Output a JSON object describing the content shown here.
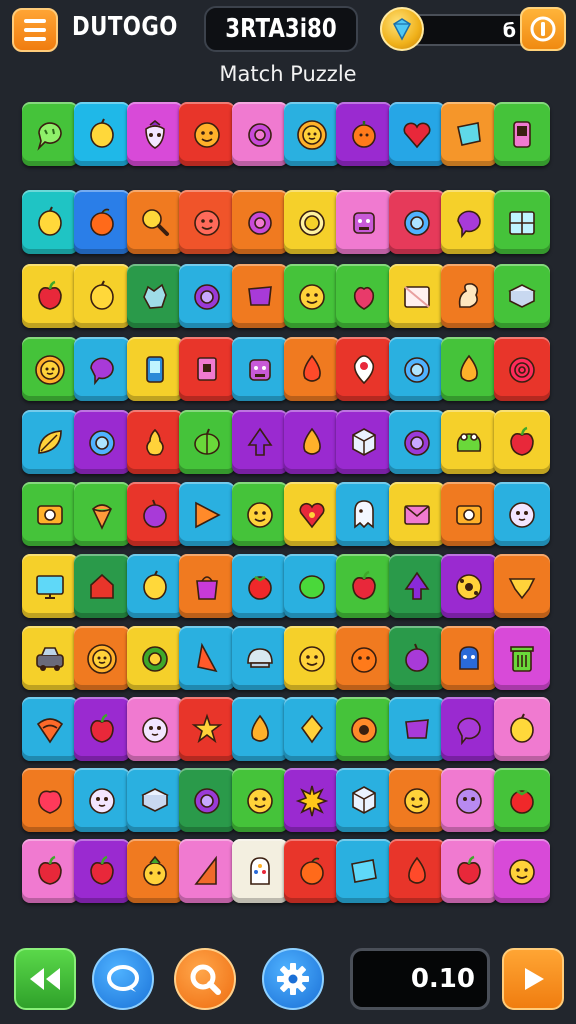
{
  "header": {
    "brand": "DUTOGO",
    "code": "3RTA3i80",
    "coin_count": "б",
    "subtitle": "Match Puzzle"
  },
  "footer": {
    "timer": "0.10"
  },
  "board": {
    "rows": [
      [
        {
          "icon": "speech-bubble",
          "color": "#45c33a"
        },
        {
          "icon": "lemon",
          "color": "#1fb8e8"
        },
        {
          "icon": "strawberry",
          "color": "#d84ad8"
        },
        {
          "icon": "smiley-orange",
          "color": "#e8352a"
        },
        {
          "icon": "ring",
          "color": "#f07ad0"
        },
        {
          "icon": "sun-face",
          "color": "#2ab0e0"
        },
        {
          "icon": "orange-face",
          "color": "#9a2ad0"
        },
        {
          "icon": "heart",
          "color": "#26a6e6"
        },
        {
          "icon": "gem-square",
          "color": "#f5962a"
        },
        {
          "icon": "phone",
          "color": "#45c33a"
        }
      ],
      [
        {
          "icon": "lemon",
          "color": "#1fc4c4"
        },
        {
          "icon": "orange",
          "color": "#2a7ee8"
        },
        {
          "icon": "magnifier",
          "color": "#f07a20"
        },
        {
          "icon": "smiley-red",
          "color": "#f0542a"
        },
        {
          "icon": "ring",
          "color": "#f07a20"
        },
        {
          "icon": "ring-yellow",
          "color": "#f5d02a"
        },
        {
          "icon": "robot",
          "color": "#f07ad0"
        },
        {
          "icon": "ring-blue",
          "color": "#e63a5a"
        },
        {
          "icon": "bubble-purple",
          "color": "#f5d02a"
        },
        {
          "icon": "window",
          "color": "#45c33a"
        }
      ],
      [
        {
          "icon": "apple",
          "color": "#f5d02a"
        },
        {
          "icon": "lemon",
          "color": "#f5d02a"
        },
        {
          "icon": "splat",
          "color": "#2a9a4a"
        },
        {
          "icon": "ring-purple",
          "color": "#2ab0e0"
        },
        {
          "icon": "gem-purple",
          "color": "#f07a20"
        },
        {
          "icon": "smiley-yellow",
          "color": "#45c33a"
        },
        {
          "icon": "berry",
          "color": "#45c33a"
        },
        {
          "icon": "card",
          "color": "#f5d02a"
        },
        {
          "icon": "squirrel",
          "color": "#f07a20"
        },
        {
          "icon": "book",
          "color": "#45c33a"
        }
      ],
      [
        {
          "icon": "sun-face",
          "color": "#45c33a"
        },
        {
          "icon": "bubble-purple",
          "color": "#2ab0e0"
        },
        {
          "icon": "phone-blue",
          "color": "#f5d02a"
        },
        {
          "icon": "box-pink",
          "color": "#e8352a"
        },
        {
          "icon": "robot",
          "color": "#2ab0e0"
        },
        {
          "icon": "drop-red",
          "color": "#f07a20"
        },
        {
          "icon": "pin-red",
          "color": "#e8352a"
        },
        {
          "icon": "ring-blue",
          "color": "#2ab0e0"
        },
        {
          "icon": "drop-orange",
          "color": "#45c33a"
        },
        {
          "icon": "rose",
          "color": "#e8352a"
        }
      ],
      [
        {
          "icon": "leaf",
          "color": "#2ab0e0"
        },
        {
          "icon": "ring-blue",
          "color": "#9a2ad0"
        },
        {
          "icon": "pear",
          "color": "#e8352a"
        },
        {
          "icon": "pumpkin",
          "color": "#45c33a"
        },
        {
          "icon": "arrow-up",
          "color": "#9a2ad0"
        },
        {
          "icon": "drop-orange",
          "color": "#9a2ad0"
        },
        {
          "icon": "cube",
          "color": "#9a2ad0"
        },
        {
          "icon": "ring-purple",
          "color": "#2ab0e0"
        },
        {
          "icon": "frog",
          "color": "#f5d02a"
        },
        {
          "icon": "apple",
          "color": "#f5d02a"
        }
      ],
      [
        {
          "icon": "camera",
          "color": "#45c33a"
        },
        {
          "icon": "acorn",
          "color": "#45c33a"
        },
        {
          "icon": "plum",
          "color": "#e8352a"
        },
        {
          "icon": "triangle",
          "color": "#2ab0e0"
        },
        {
          "icon": "smiley-yellow",
          "color": "#45c33a"
        },
        {
          "icon": "heart-red",
          "color": "#f5d02a"
        },
        {
          "icon": "ghost",
          "color": "#2ab0e0"
        },
        {
          "icon": "envelope",
          "color": "#f5d02a"
        },
        {
          "icon": "camera",
          "color": "#f07a20"
        },
        {
          "icon": "ghost-face",
          "color": "#2ab0e0"
        }
      ],
      [
        {
          "icon": "monitor",
          "color": "#f5d02a"
        },
        {
          "icon": "house-red",
          "color": "#2a9a4a"
        },
        {
          "icon": "lemon",
          "color": "#2ab0e0"
        },
        {
          "icon": "bag",
          "color": "#f07a20"
        },
        {
          "icon": "tomato",
          "color": "#2ab0e0"
        },
        {
          "icon": "lime",
          "color": "#2ab0e0"
        },
        {
          "icon": "apple",
          "color": "#45c33a"
        },
        {
          "icon": "arrow-up",
          "color": "#2a9a4a"
        },
        {
          "icon": "sun-wheel",
          "color": "#9a2ad0"
        },
        {
          "icon": "banana",
          "color": "#f07a20"
        }
      ],
      [
        {
          "icon": "car",
          "color": "#f5d02a"
        },
        {
          "icon": "sun-face",
          "color": "#f07a20"
        },
        {
          "icon": "ring-green",
          "color": "#f5d02a"
        },
        {
          "icon": "wedge",
          "color": "#2ab0e0"
        },
        {
          "icon": "helmet",
          "color": "#2ab0e0"
        },
        {
          "icon": "smiley-yellow",
          "color": "#f5d02a"
        },
        {
          "icon": "pumpkin-face",
          "color": "#f07a20"
        },
        {
          "icon": "plum",
          "color": "#2a9a4a"
        },
        {
          "icon": "robot-blue",
          "color": "#f07a20"
        },
        {
          "icon": "trash",
          "color": "#d84ad8"
        }
      ],
      [
        {
          "icon": "wifi",
          "color": "#2ab0e0"
        },
        {
          "icon": "apple",
          "color": "#9a2ad0"
        },
        {
          "icon": "ghost-face",
          "color": "#f07ad0"
        },
        {
          "icon": "star-burst",
          "color": "#e8352a"
        },
        {
          "icon": "drop-orange",
          "color": "#2ab0e0"
        },
        {
          "icon": "gem-yellow",
          "color": "#2ab0e0"
        },
        {
          "icon": "donut",
          "color": "#45c33a"
        },
        {
          "icon": "gem-purple",
          "color": "#2ab0e0"
        },
        {
          "icon": "bubble-purple",
          "color": "#9a2ad0"
        },
        {
          "icon": "lemon",
          "color": "#f07ad0"
        }
      ],
      [
        {
          "icon": "peach",
          "color": "#f07a20"
        },
        {
          "icon": "ghost-face",
          "color": "#2ab0e0"
        },
        {
          "icon": "book",
          "color": "#2ab0e0"
        },
        {
          "icon": "ring-purple",
          "color": "#2a9a4a"
        },
        {
          "icon": "smiley-yellow",
          "color": "#45c33a"
        },
        {
          "icon": "sun-burst",
          "color": "#9a2ad0"
        },
        {
          "icon": "cube",
          "color": "#2ab0e0"
        },
        {
          "icon": "smiley-yellow",
          "color": "#f07a20"
        },
        {
          "icon": "ghost-purple",
          "color": "#f07ad0"
        },
        {
          "icon": "tomato",
          "color": "#45c33a"
        }
      ],
      [
        {
          "icon": "apple",
          "color": "#f07ad0"
        },
        {
          "icon": "apple",
          "color": "#9a2ad0"
        },
        {
          "icon": "pineapple-face",
          "color": "#f07a20"
        },
        {
          "icon": "triangle-red",
          "color": "#f07ad0"
        },
        {
          "icon": "ghost-tile",
          "color": "#f3efe0"
        },
        {
          "icon": "orange",
          "color": "#e8352a"
        },
        {
          "icon": "card-blue",
          "color": "#2ab0e0"
        },
        {
          "icon": "drop-red",
          "color": "#e8352a"
        },
        {
          "icon": "apple",
          "color": "#f07ad0"
        },
        {
          "icon": "smiley-yellow",
          "color": "#d84ad8"
        }
      ]
    ]
  }
}
